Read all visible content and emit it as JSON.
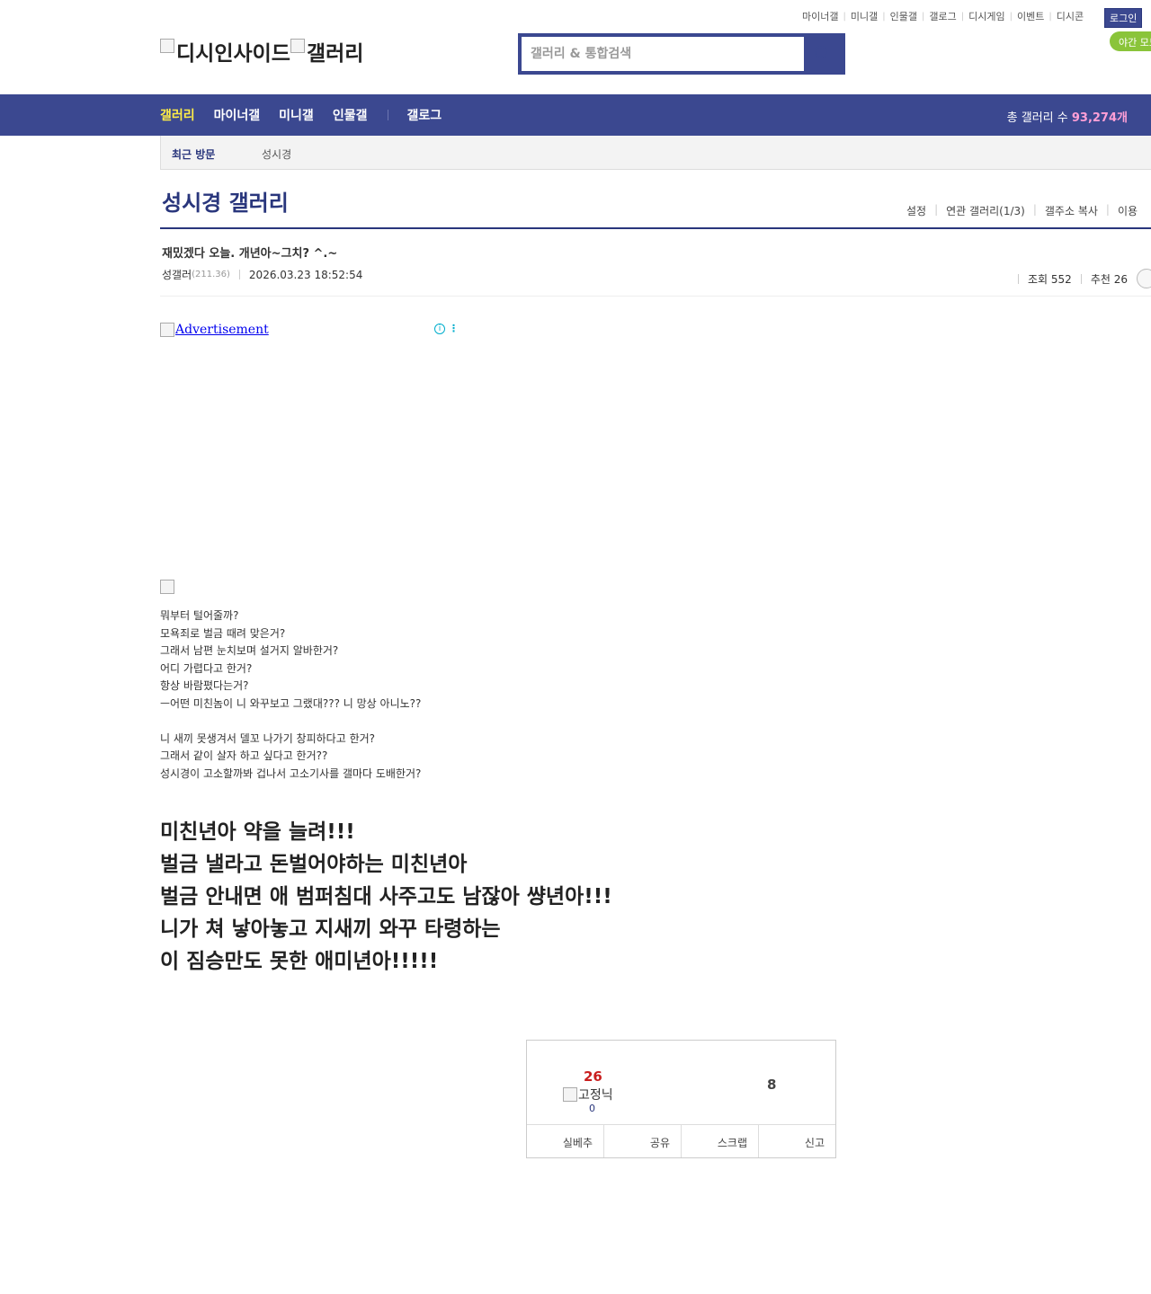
{
  "top_links": [
    "마이너갤",
    "미니갤",
    "인물갤",
    "갤로그",
    "디시게임",
    "이벤트",
    "디시콘"
  ],
  "login_label": "로그인",
  "night_mode_label": "야간 모드",
  "logo": {
    "main_alt": "디시인사이드",
    "sub_alt": "갤러리"
  },
  "search": {
    "placeholder": "갤러리 & 통합검색"
  },
  "nav": {
    "items": [
      "갤러리",
      "마이너갤",
      "미니갤",
      "인물갤"
    ],
    "extra": "갤로그",
    "count_label": "총 갤러리 수",
    "count_value": "93,274개"
  },
  "recent": {
    "label": "최근 방문",
    "visited": "성시경"
  },
  "gallery": {
    "title": "성시경 갤러리",
    "tools": [
      "설정",
      "연관 갤러리(1/3)",
      "갤주소 복사",
      "이용"
    ]
  },
  "post": {
    "title": "재밌겠다 오늘. 개년아~그치? ^.~",
    "author": "성갤러",
    "ip": "(211.36)",
    "date": "2026.03.23 18:52:54",
    "views_label": "조회 552",
    "recommend_label": "추천 26"
  },
  "ad": {
    "alt": "Advertisement"
  },
  "body_lines": [
    "뭐부터 털어줄까?",
    "모욕죄로 벌금 때려 맞은거?",
    "그래서 남편 눈치보며 설거지 알바한거?",
    "어디 가렵다고 한거?",
    "항상 바람폈다는거?",
    "ㅡ어떤 미친놈이 니 와꾸보고 그랬대??? 니 망상 아니노??",
    "",
    "니 새끼 못생겨서 델꼬 나가기 창피하다고 한거?",
    "그래서 같이 살자 하고 싶다고 한거??",
    "성시경이 고소할까봐 겁나서 고소기사를 갤마다 도배한거?"
  ],
  "big_lines": [
    "미친년아 약을 늘려!!!",
    "벌금 낼라고 돈벌어야하는 미친년아",
    "벌금 안내면 애 범퍼침대 사주고도 남잖아 썅년아!!!",
    "니가 쳐 낳아놓고 지새끼 와꾸 타령하는",
    "이 짐승만도 못한 애미년아!!!!!"
  ],
  "recommend_box": {
    "up_count": "26",
    "fixed_alt": "고정닉",
    "fixed_count": "0",
    "down_count": "8",
    "actions": [
      "실베추",
      "공유",
      "스크랩",
      "신고"
    ]
  }
}
